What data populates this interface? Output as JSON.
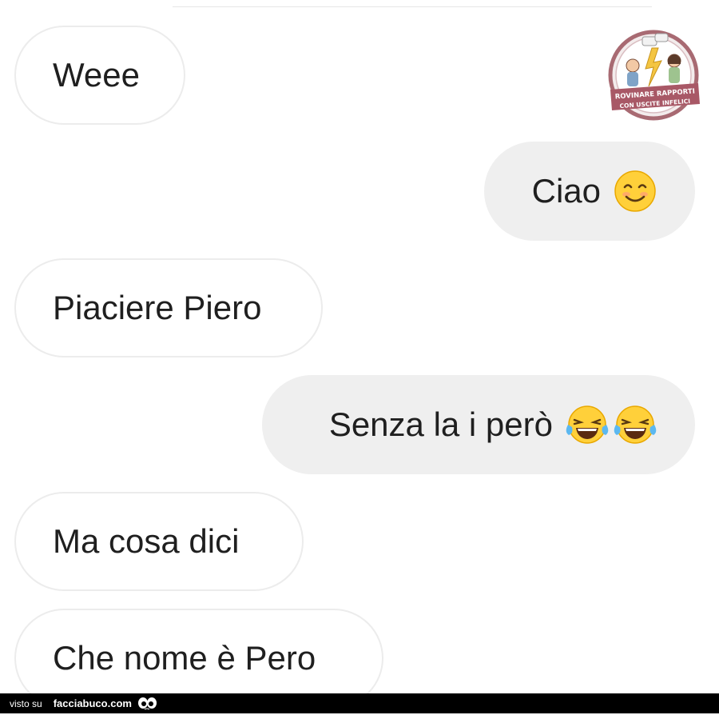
{
  "messages": [
    {
      "side": "incoming",
      "text": "Weee"
    },
    {
      "side": "outgoing",
      "text": "Ciao",
      "emoji": [
        "smiling-face-icon"
      ]
    },
    {
      "side": "incoming",
      "text": "Piaciere Piero"
    },
    {
      "side": "outgoing",
      "text": "Senza la i però",
      "emoji": [
        "tears-of-joy-icon",
        "tears-of-joy-icon"
      ]
    },
    {
      "side": "incoming",
      "text": "Ma cosa dici"
    },
    {
      "side": "incoming",
      "text": "Che nome è Pero"
    }
  ],
  "watermark": {
    "line1": "ROVINARE RAPPORTI",
    "line2": "CON USCITE INFELICI"
  },
  "footer": {
    "visto": "visto su",
    "site": "facciabuco.com"
  },
  "colors": {
    "incoming_bubble": "#ffffff",
    "outgoing_bubble": "#efefef",
    "text": "#1f1f1f",
    "footer_bg": "#000000"
  }
}
